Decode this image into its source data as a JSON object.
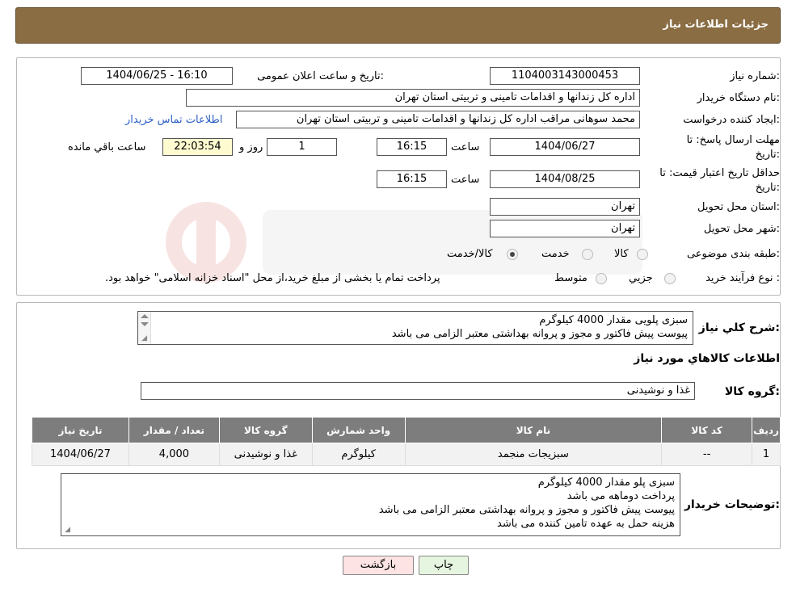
{
  "header": {
    "title": "جزئیات اطلاعات نیاز"
  },
  "form": {
    "need_number_label": "شماره نیاز:",
    "need_number": "1104003143000453",
    "announce_label": "تاریخ و ساعت اعلان عمومی:",
    "announce_value": "1404/06/25 - 16:10",
    "buyer_org_label": "نام دستگاه خریدار:",
    "buyer_org": "اداره کل زندانها و اقدامات تامینی و تربیتی استان تهران",
    "requester_label": "ایجاد کننده درخواست:",
    "requester": "محمد سوهانی مراقب  اداره کل زندانها و اقدامات تامینی و تربیتی استان تهران",
    "contact_link": "اطلاعات تماس خریدار",
    "deadline_label_1": "مهلت ارسال پاسخ: تا",
    "deadline_label_2": "تاریخ:",
    "deadline_date": "1404/06/27",
    "time_label": "ساعت",
    "deadline_time": "16:15",
    "days": "1",
    "days_label": "روز و",
    "remaining_time": "22:03:54",
    "remaining_label": "ساعت باقي مانده",
    "validity_label_1": "حداقل تاریخ اعتبار قیمت: تا",
    "validity_label_2": "تاریخ:",
    "validity_date": "1404/08/25",
    "validity_time": "16:15",
    "province_label": "استان محل تحویل:",
    "province": "تهران",
    "city_label": "شهر محل تحویل:",
    "city": "تهران",
    "category_label": "طبقه بندی موضوعی:",
    "category_options": [
      "کالا",
      "خدمت",
      "کالا/خدمت"
    ],
    "process_label": "نوع فرآیند خرید :",
    "process_options": [
      "جزیي",
      "متوسط"
    ],
    "process_note": "پرداخت تمام یا بخشی از مبلغ خرید،از محل \"اسناد خزانه اسلامی\" خواهد بود."
  },
  "details": {
    "summary_label": "شرح کلي نياز:",
    "summary_lines": [
      "سبزی پلویی مقدار 4000 کیلوگرم",
      "پیوست پیش فاکتور و مجوز و پروانه بهداشتی معتبر الزامی می باشد"
    ],
    "goods_info_title": "اطلاعات کالاهاي مورد نياز",
    "goods_group_label": "گروه کالا:",
    "goods_group": "غذا و نوشیدنی",
    "table": {
      "headers": [
        "ردیف",
        "کد کالا",
        "نام کالا",
        "واحد شمارش",
        "گروه کالا",
        "تعداد / مقدار",
        "تاریخ نیاز"
      ],
      "rows": [
        [
          "1",
          "--",
          "سبزیجات منجمد",
          "کیلوگرم",
          "غذا و نوشیدنی",
          "4,000",
          "1404/06/27"
        ]
      ]
    },
    "buyer_notes_label": "توضیحات خریدار:",
    "buyer_notes_lines": [
      "سبزی پلو مقدار 4000 کیلوگرم",
      "پرداخت دوماهه می باشد",
      "پیوست پیش فاکتور و مجوز و پروانه بهداشتی معتبر الزامی می باشد",
      "هزینه حمل به عهده تامین کننده می باشد"
    ]
  },
  "buttons": {
    "print": "چاپ",
    "back": "بازگشت"
  },
  "colors": {
    "header": "#8a6d43",
    "table_header": "#7d7d7d",
    "link": "#2b5fc5"
  }
}
